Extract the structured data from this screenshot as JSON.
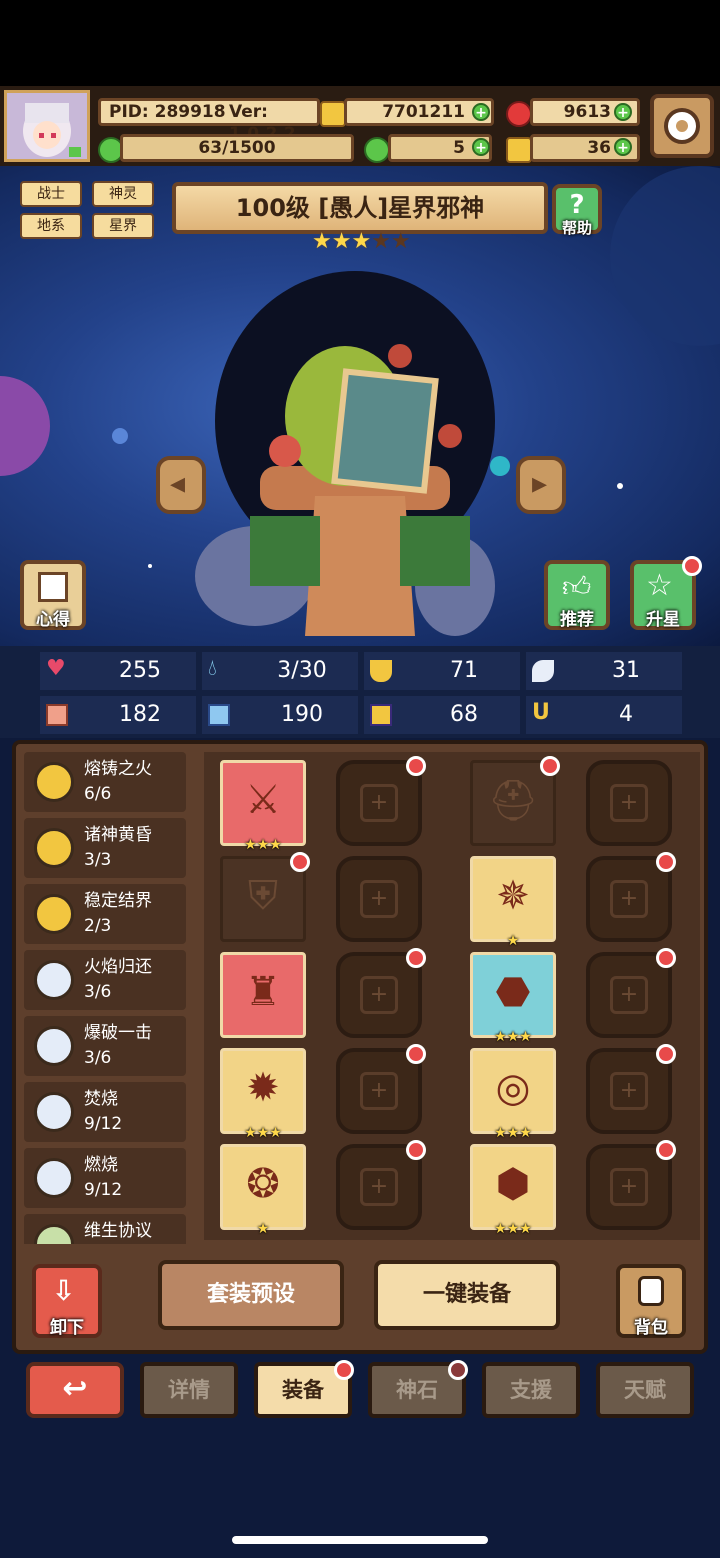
{
  "header": {
    "pid": "PID: 289918",
    "version": "Ver: 1.0.2.2",
    "gold": "7701211",
    "gems": "9613",
    "exp": "63/1500",
    "clover": "5",
    "key": "36"
  },
  "hero": {
    "tags": [
      "战士",
      "神灵",
      "地系",
      "星界"
    ],
    "title": "100级 [愚人]星界邪神",
    "stars_filled": 3,
    "stars_total": 5,
    "help_label": "帮助",
    "notes_label": "心得",
    "recommend_label": "推荐",
    "starup_label": "升星"
  },
  "stats": [
    {
      "icon": "heart-icon",
      "value": "255"
    },
    {
      "icon": "water-drop-icon",
      "value": "3/30"
    },
    {
      "icon": "shield-icon",
      "value": "71"
    },
    {
      "icon": "wing-icon",
      "value": "31"
    },
    {
      "icon": "fist-icon",
      "value": "182"
    },
    {
      "icon": "book-icon",
      "value": "190"
    },
    {
      "icon": "scroll-icon",
      "value": "68"
    },
    {
      "icon": "horseshoe-icon",
      "value": "4"
    }
  ],
  "sets": [
    {
      "name": "熔铸之火",
      "count": "6/6",
      "tier": "gold"
    },
    {
      "name": "诸神黄昏",
      "count": "3/3",
      "tier": "gold"
    },
    {
      "name": "稳定结界",
      "count": "2/3",
      "tier": "gold"
    },
    {
      "name": "火焰归还",
      "count": "3/6",
      "tier": "silver"
    },
    {
      "name": "爆破一击",
      "count": "3/6",
      "tier": "silver"
    },
    {
      "name": "焚烧",
      "count": "9/12",
      "tier": "silver"
    },
    {
      "name": "燃烧",
      "count": "9/12",
      "tier": "silver"
    },
    {
      "name": "维生协议",
      "count": "",
      "tier": "green"
    }
  ],
  "slots": [
    {
      "kind": "item",
      "icon": "crossed-swords-icon",
      "bg": "#e86a6a",
      "stars": "★★★",
      "dot": false
    },
    {
      "kind": "empty",
      "dot": true
    },
    {
      "kind": "ghost",
      "icon": "helmet-icon",
      "dot": true
    },
    {
      "kind": "empty",
      "dot": false
    },
    {
      "kind": "ghost",
      "icon": "shield-outline-icon",
      "dot": true
    },
    {
      "kind": "empty",
      "dot": false
    },
    {
      "kind": "item",
      "icon": "amulet-icon",
      "bg": "#f2d487",
      "stars": "★",
      "dot": false
    },
    {
      "kind": "empty",
      "dot": true
    },
    {
      "kind": "item",
      "icon": "armor-icon",
      "bg": "#e86a6a",
      "stars": "",
      "dot": false
    },
    {
      "kind": "empty",
      "dot": true
    },
    {
      "kind": "item",
      "icon": "boot-icon",
      "bg": "#7fd0d8",
      "stars": "★★★",
      "dot": false
    },
    {
      "kind": "empty",
      "dot": true
    },
    {
      "kind": "item",
      "icon": "fire-gem-icon",
      "bg": "#f2d487",
      "stars": "★★★",
      "dot": false
    },
    {
      "kind": "empty",
      "dot": true
    },
    {
      "kind": "item",
      "icon": "ring-icon",
      "bg": "#f2d487",
      "stars": "★★★",
      "dot": false
    },
    {
      "kind": "empty",
      "dot": true
    },
    {
      "kind": "item",
      "icon": "necklace-icon",
      "bg": "#f2d487",
      "stars": "★",
      "dot": false
    },
    {
      "kind": "empty",
      "dot": true
    },
    {
      "kind": "item",
      "icon": "boots-icon",
      "bg": "#f2d487",
      "stars": "★★★",
      "dot": false
    },
    {
      "kind": "empty",
      "dot": true
    }
  ],
  "actions": {
    "unequip": "卸下",
    "preset": "套装预设",
    "equip_all": "一键装备",
    "bag": "背包"
  },
  "tabs": [
    {
      "label": "详情",
      "active": false,
      "dot": false
    },
    {
      "label": "装备",
      "active": true,
      "dot": true
    },
    {
      "label": "神石",
      "active": false,
      "dot": true
    },
    {
      "label": "支援",
      "active": false,
      "dot": false
    },
    {
      "label": "天赋",
      "active": false,
      "dot": false
    }
  ],
  "colors": {
    "panel": "#5e3f2c",
    "cream": "#f4dcaa",
    "badge": "#e84a4a",
    "sky": "#23428a"
  }
}
